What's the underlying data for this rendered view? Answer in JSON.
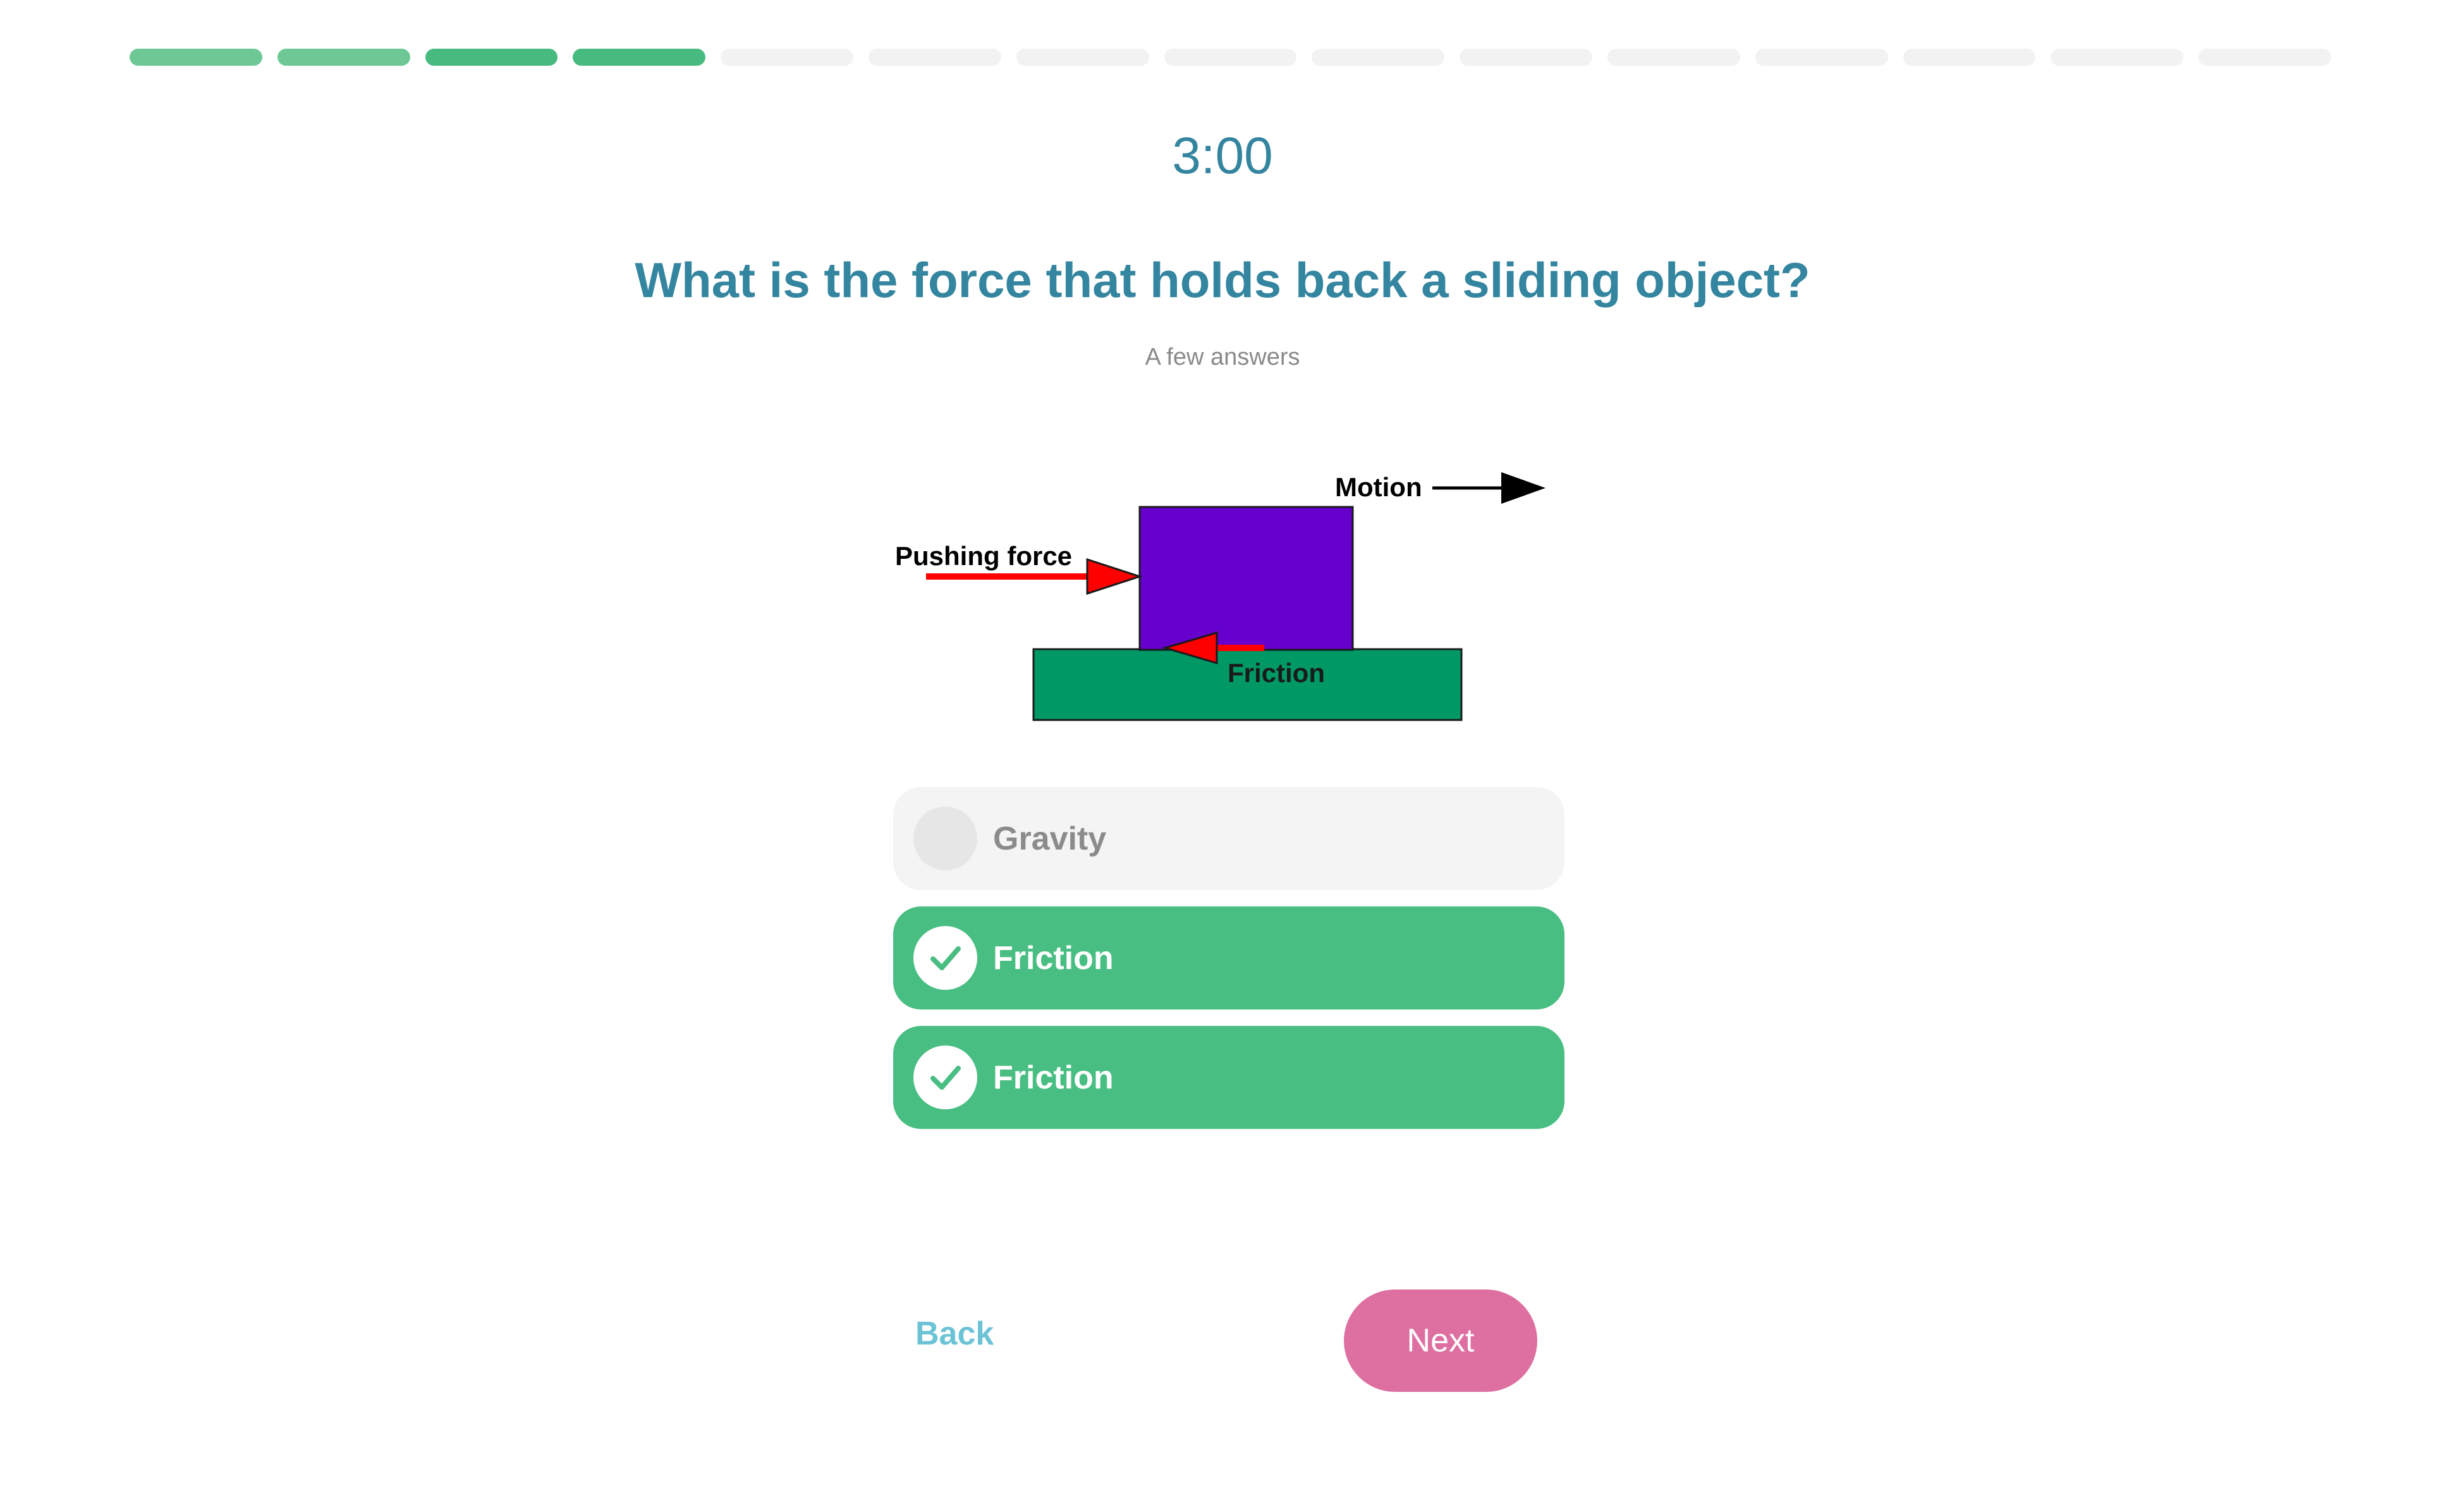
{
  "progress": {
    "total_steps": 15,
    "completed_steps": 4
  },
  "timer": {
    "text": "3:00"
  },
  "question": {
    "text": "What is the force that holds back a sliding object?",
    "subtitle": "A few answers"
  },
  "diagram": {
    "labels": {
      "motion": "Motion",
      "pushing_force": "Pushing force",
      "friction": "Friction"
    },
    "colors": {
      "block": "#6600cc",
      "ground": "#009966",
      "force_arrow": "#ff0000"
    }
  },
  "answers": [
    {
      "label": "Gravity",
      "selected": false,
      "icon": "empty-radio"
    },
    {
      "label": "Friction",
      "selected": true,
      "icon": "check-icon"
    },
    {
      "label": "Friction",
      "selected": true,
      "icon": "check-icon"
    }
  ],
  "nav": {
    "back_label": "Back",
    "next_label": "Next"
  },
  "colors": {
    "accent": "#34859f",
    "selected": "#49be83",
    "next_button": "#de6fa1",
    "back_link": "#6cc3d5"
  }
}
